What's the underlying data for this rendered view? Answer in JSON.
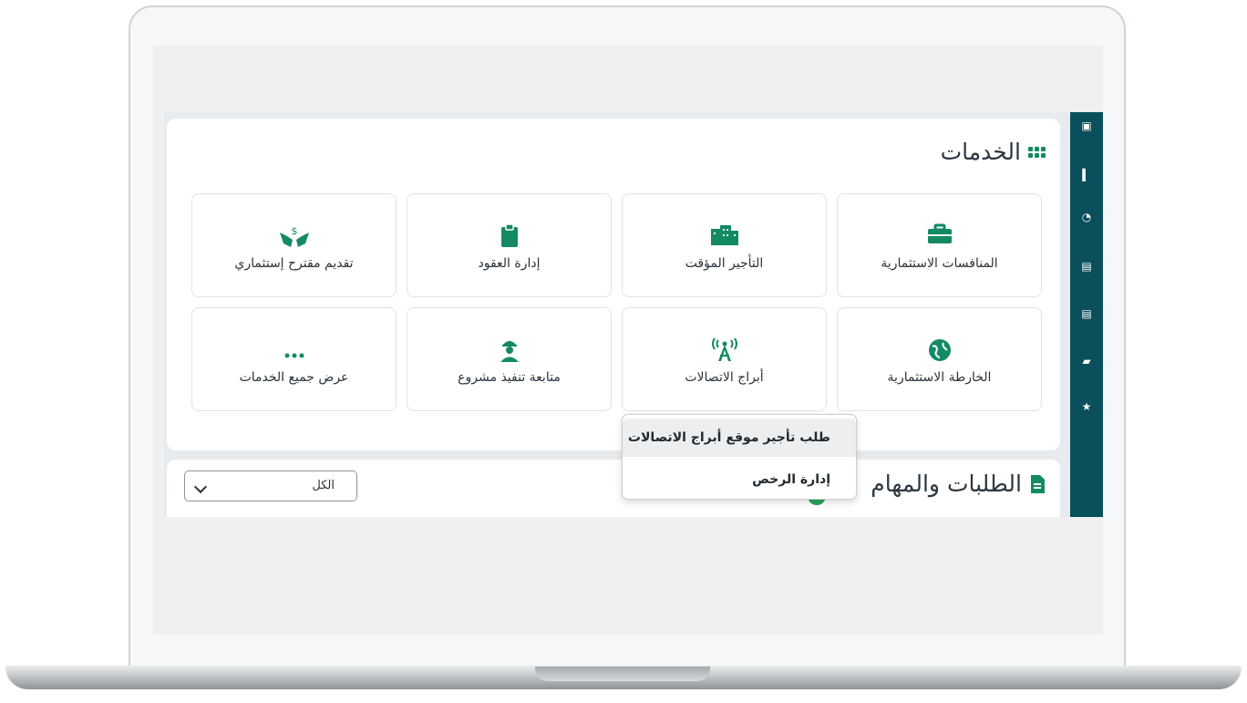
{
  "services": {
    "title": "الخدمات",
    "tiles": [
      {
        "label": "المنافسات الاستثمارية",
        "icon": "briefcase-icon"
      },
      {
        "label": "التأجير المؤقت",
        "icon": "buildings-icon"
      },
      {
        "label": "إدارة العقود",
        "icon": "clipboard-icon"
      },
      {
        "label": "تقديم مقترح إستثماري",
        "icon": "hands-money-icon"
      },
      {
        "label": "الخارطة الاستثمارية",
        "icon": "globe-icon"
      },
      {
        "label": "أبراج الاتصالات",
        "icon": "antenna-tower-icon"
      },
      {
        "label": "متابعة تنفيذ مشروع",
        "icon": "worker-icon"
      },
      {
        "label": "عرض جميع الخدمات",
        "icon": "more-dots-icon"
      }
    ]
  },
  "tower_menu": {
    "items": [
      "طلب تأجير موقع أبراج الاتصالات",
      "إدارة الرخص"
    ]
  },
  "requests": {
    "title": "الطلبات والمهام",
    "filter_value": "الكل"
  },
  "colors": {
    "accent": "#138a64",
    "rail": "#0a4f5c"
  }
}
